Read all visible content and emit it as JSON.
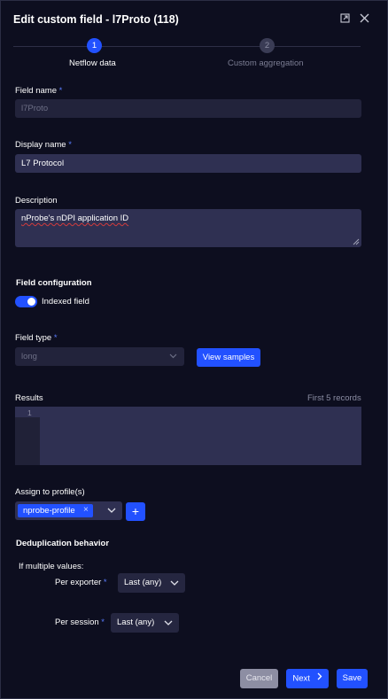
{
  "modal": {
    "title": "Edit custom field - l7Proto (118)",
    "expand_icon": "expand-icon",
    "close_icon": "close-icon"
  },
  "stepper": {
    "steps": [
      {
        "number": "1",
        "label": "Netflow data",
        "state": "active"
      },
      {
        "number": "2",
        "label": "Custom aggregation",
        "state": "inactive"
      }
    ]
  },
  "form": {
    "field_name": {
      "label": "Field name",
      "required": "*",
      "value": "l7Proto"
    },
    "display_name": {
      "label": "Display name",
      "required": "*",
      "value": "L7 Protocol"
    },
    "description": {
      "label": "Description",
      "value": "nProbe's nDPI application ID"
    },
    "field_configuration": {
      "heading": "Field configuration",
      "toggle_label": "Indexed field",
      "toggle_on": true
    },
    "field_type": {
      "label": "Field type",
      "required": "*",
      "value": "long",
      "button": "View samples"
    },
    "results": {
      "label": "Results",
      "hint": "First 5 records",
      "line_number": "1"
    },
    "profiles": {
      "label": "Assign to profile(s)",
      "chip": "nprobe-profile",
      "chip_remove": "×",
      "add_icon": "+"
    },
    "deduplication": {
      "heading": "Deduplication behavior",
      "subheading": "If multiple values:",
      "per_exporter": {
        "label": "Per exporter",
        "required": "*",
        "value": "Last (any)"
      },
      "per_session": {
        "label": "Per session",
        "required": "*",
        "value": "Last (any)"
      }
    }
  },
  "footer": {
    "cancel": "Cancel",
    "next": "Next",
    "next_icon": "chevron-right-icon",
    "save": "Save"
  },
  "colors": {
    "background": "#0d0e1f",
    "accent": "#2251ff",
    "input": "#2f3052",
    "input_disabled": "#22233b"
  }
}
